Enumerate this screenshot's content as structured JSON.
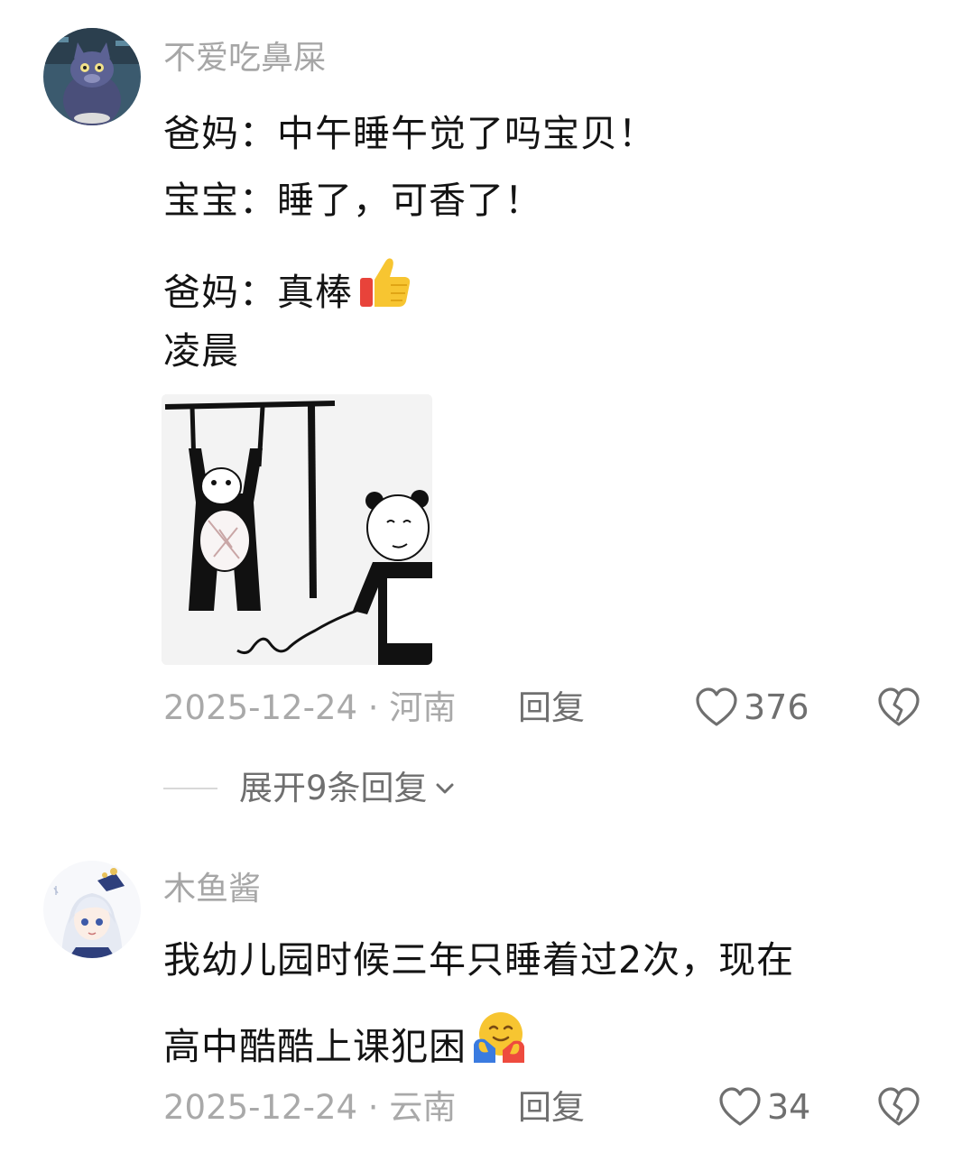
{
  "comments": [
    {
      "username": "不爱吃鼻屎",
      "lines": [
        "爸妈：中午睡午觉了吗宝贝！",
        "宝宝：睡了，可香了！",
        "爸妈：真棒",
        "凌晨"
      ],
      "emoji": "thumbs-up",
      "date": "2025-12-24",
      "location": "河南",
      "reply_label": "回复",
      "likes": "376",
      "expand_label": "展开9条回复"
    },
    {
      "username": "木鱼酱",
      "lines": [
        "我幼儿园时候三年只睡着过2次，现在",
        "高中酷酷上课犯困"
      ],
      "emoji": "hugging-face",
      "date": "2025-12-24",
      "location": "云南",
      "reply_label": "回复",
      "likes": "34"
    }
  ],
  "separator": " · ",
  "colors": {
    "text": "#141414",
    "muted": "#a6a6a6",
    "action": "#6f6f6f"
  }
}
